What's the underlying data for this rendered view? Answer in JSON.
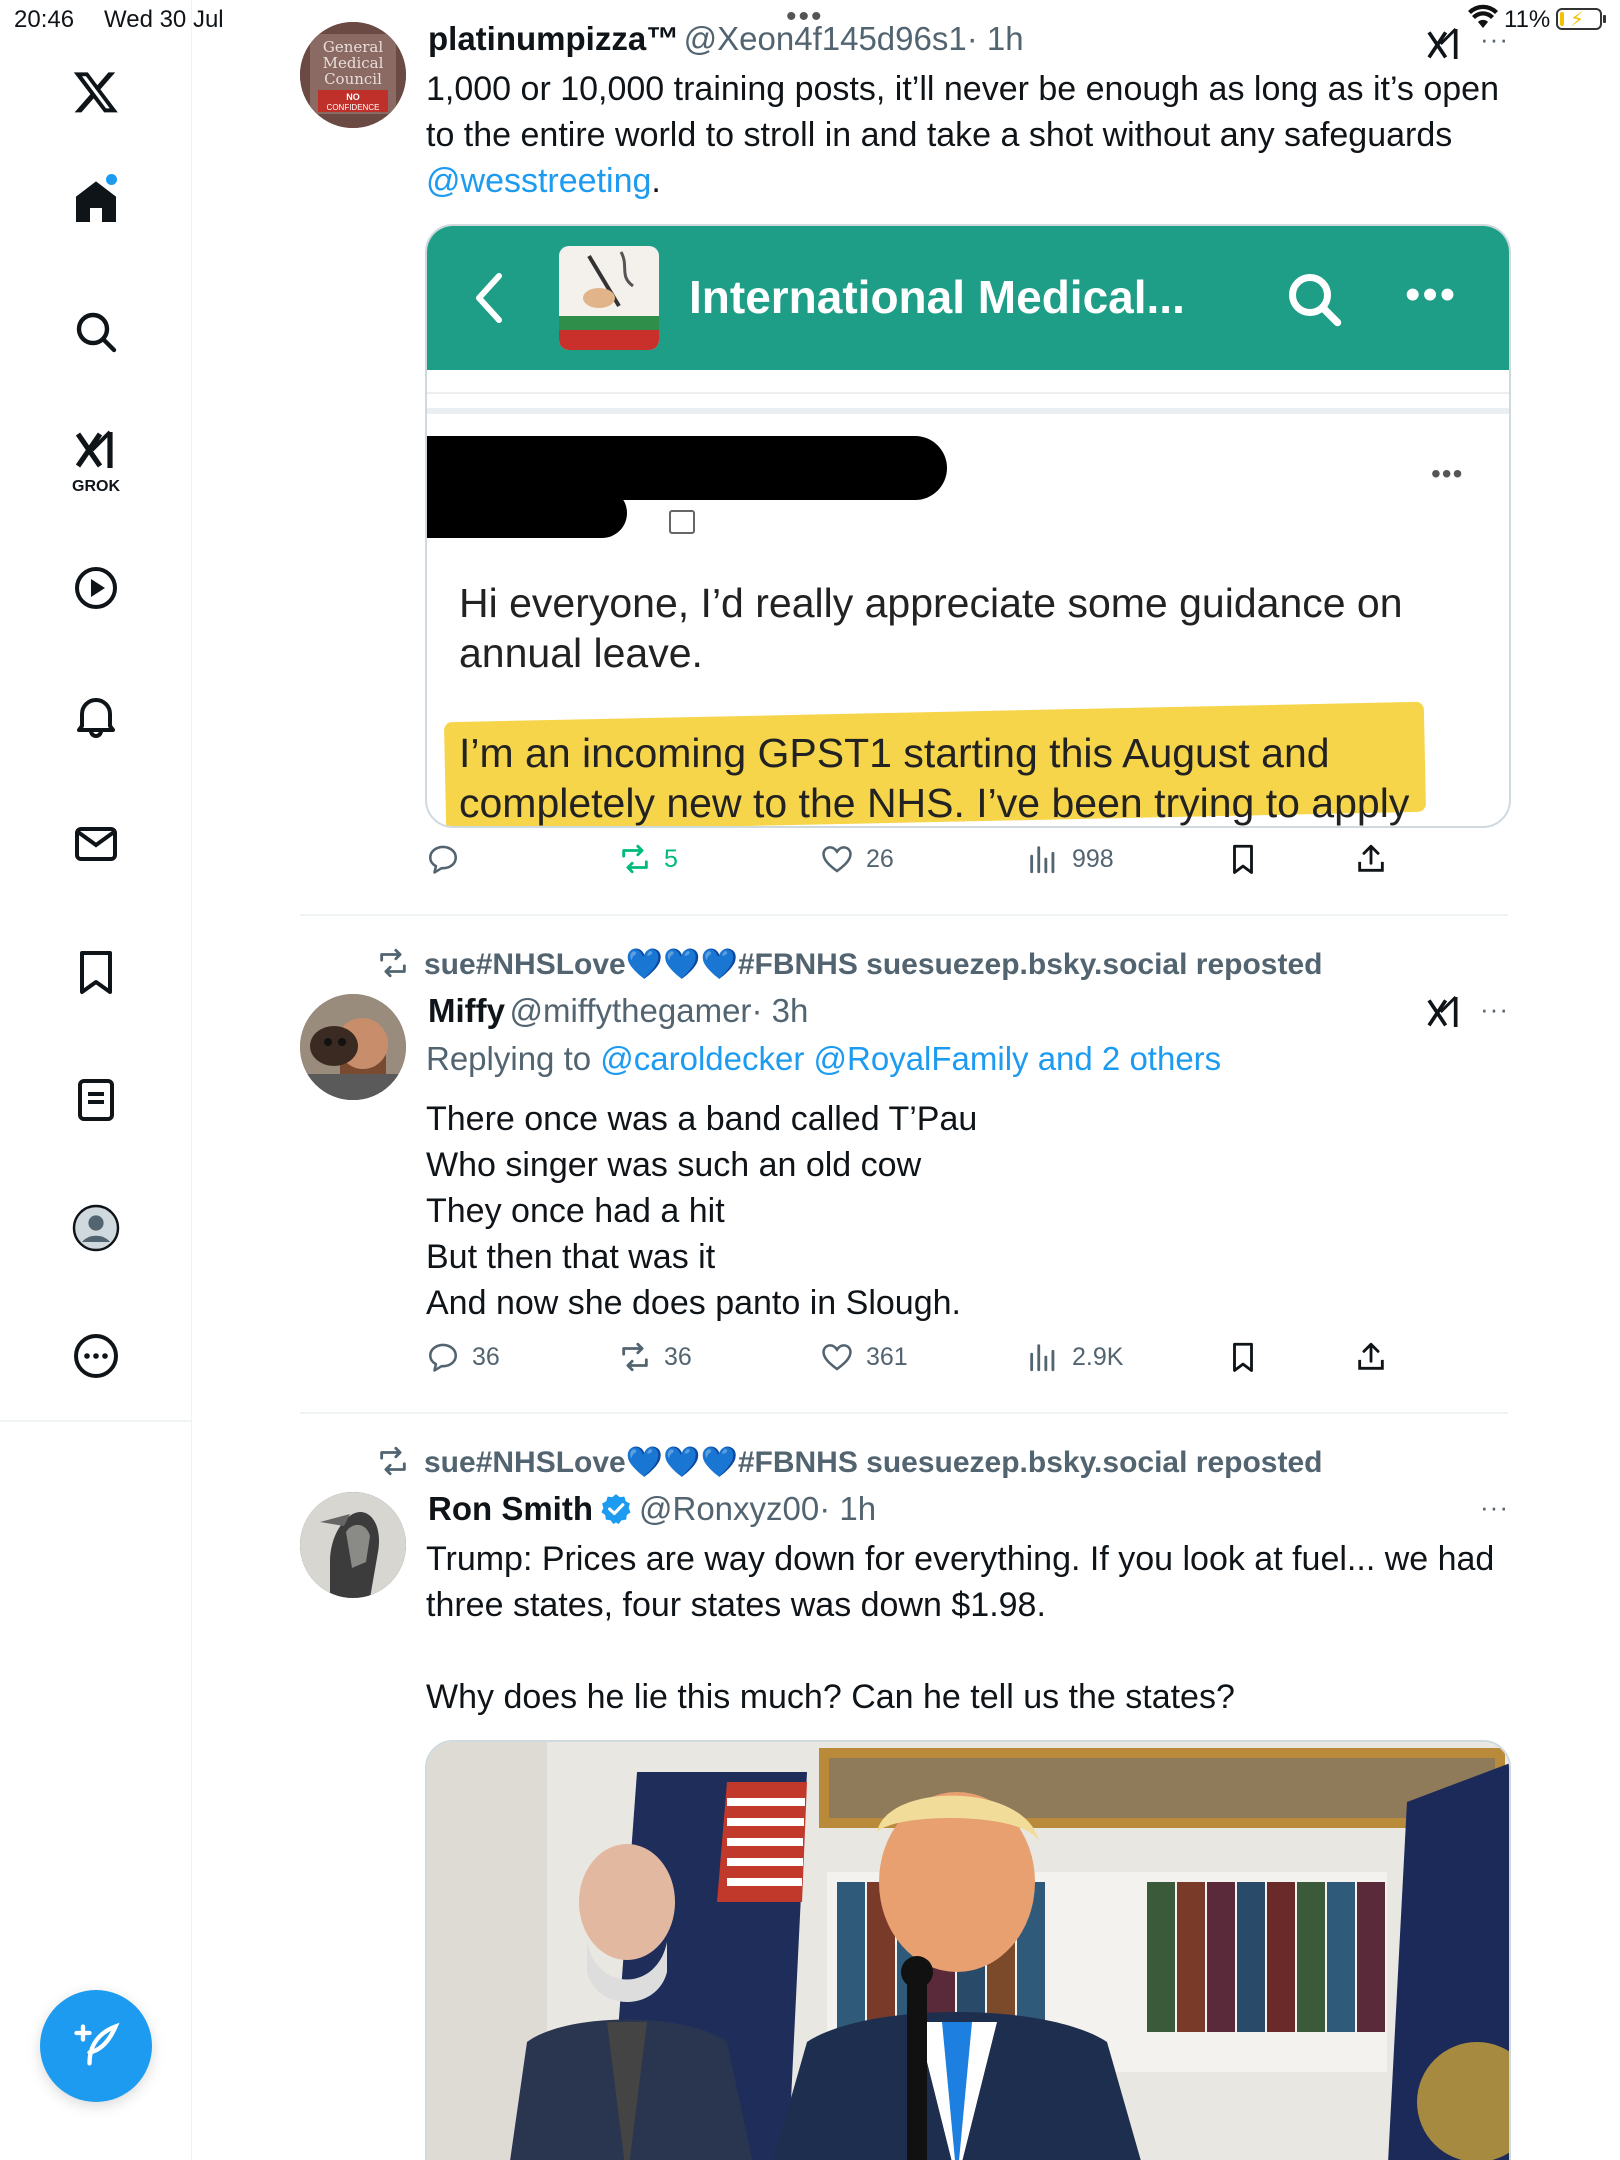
{
  "status_bar": {
    "time": "20:46",
    "date": "Wed 30 Jul",
    "battery_pct": "11%",
    "battery_level": 0.11
  },
  "sidebar": {
    "items": [
      {
        "name": "x-logo-icon"
      },
      {
        "name": "home-icon"
      },
      {
        "name": "search-icon"
      },
      {
        "name": "grok-icon",
        "label": "GROK"
      },
      {
        "name": "video-icon"
      },
      {
        "name": "notifications-icon"
      },
      {
        "name": "messages-icon"
      },
      {
        "name": "bookmarks-icon"
      },
      {
        "name": "lists-icon"
      },
      {
        "name": "profile-icon"
      },
      {
        "name": "more-icon"
      }
    ],
    "compose_icon": "compose-post-icon",
    "accent": "#1d9bf0"
  },
  "tweets": [
    {
      "name": "platinumpizza™",
      "handle": "@Xeon4f145d96s1",
      "time": "· 1h",
      "text_before_link": "1,000 or 10,000 training posts, it’ll never be enough as long as it’s open to the entire world to stroll in and take a shot without any safeguards ",
      "link": "@wesstreeting",
      "text_after_link": ".",
      "avatar_text": [
        "General",
        "Medical",
        "Council",
        "NO",
        "CONFIDENCE"
      ],
      "media": {
        "app_title": "International Medical...",
        "post_text_1": "Hi everyone, I’d really appreciate some guidance on annual leave.",
        "post_text_2a": "I’m an incoming GPST1 starting this August and",
        "post_text_2b": "completely new to the NHS. I’ve been trying to apply"
      },
      "stats": {
        "replies": "",
        "reposts": "5",
        "likes": "26",
        "views": "998"
      }
    },
    {
      "repost_by": "sue#NHSLove",
      "repost_hearts": "💙💙💙",
      "repost_suffix": "#FBNHS suesuezep.bsky.social reposted",
      "name": "Miffy",
      "handle": "@miffythegamer",
      "time": "· 3h",
      "replying_prefix": "Replying to ",
      "replying_to": "@caroldecker @RoyalFamily and 2 others",
      "lines": [
        "There once was a band called T’Pau",
        "Who singer was such an old cow",
        "They once had a hit",
        "But then that was it",
        "And now she does panto in Slough."
      ],
      "stats": {
        "replies": "36",
        "reposts": "36",
        "likes": "361",
        "views": "2.9K"
      }
    },
    {
      "repost_by": "sue#NHSLove",
      "repost_hearts": "💙💙💙",
      "repost_suffix": "#FBNHS suesuezep.bsky.social reposted",
      "name": "Ron Smith",
      "handle": "@Ronxyz00",
      "time": "· 1h",
      "text_1": "Trump: Prices are way down for everything. If you look at fuel... we had three states, four states was down $1.98.",
      "text_2": "Why does he lie this much? Can he tell us the states?"
    }
  ]
}
